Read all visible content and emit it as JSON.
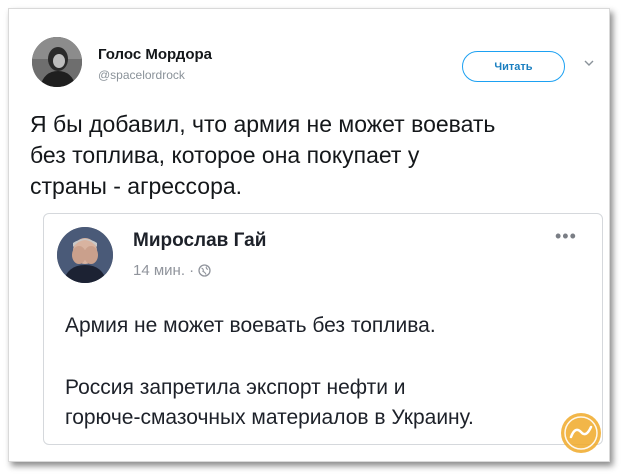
{
  "tweet": {
    "author": {
      "display_name": "Голос Мордора",
      "handle": "@spacelordrock"
    },
    "follow_label": "Читать",
    "text_lines": [
      "Я бы добавил, что армия не может воевать",
      "без топлива, которое она покупает у",
      "страны - агрессора."
    ]
  },
  "embedded_post": {
    "author_name": "Мирослав Гай",
    "time": "14 мин. ·",
    "paragraph1": "Армия не может воевать без топлива.",
    "paragraph2_lines": [
      "Россия запретила экспорт нефти и",
      "горюче-смазочных материалов в Украину."
    ],
    "more_label": "•••"
  },
  "icons": {
    "follow_chevron": "chevron-down-icon",
    "globe": "globe-icon",
    "watermark": "watermark-badge"
  },
  "colors": {
    "follow_border": "#1da1f2",
    "text": "#14171a",
    "meta": "#90949c",
    "badge": "#f0a928"
  }
}
